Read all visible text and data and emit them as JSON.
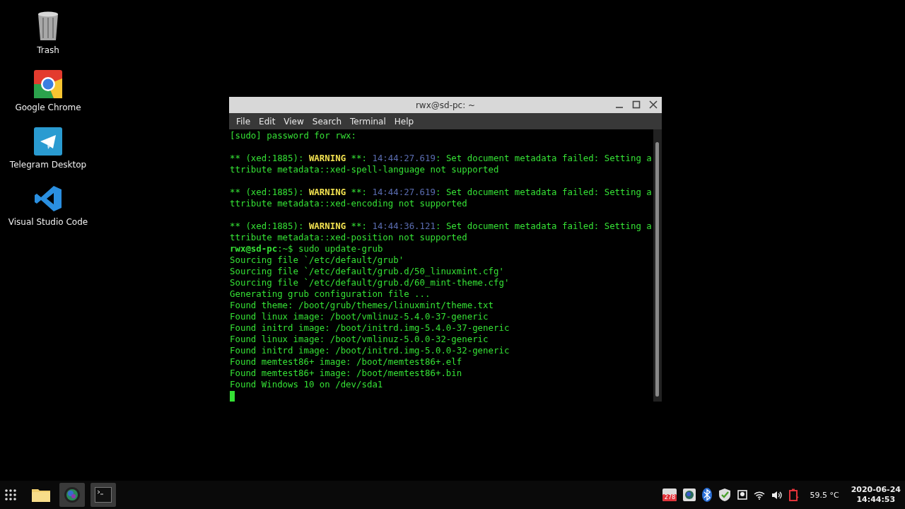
{
  "desktop_icons": [
    {
      "label": "Trash",
      "kind": "trash"
    },
    {
      "label": "Google Chrome",
      "kind": "chrome"
    },
    {
      "label": "Telegram Desktop",
      "kind": "telegram"
    },
    {
      "label": "Visual Studio Code",
      "kind": "vscode"
    }
  ],
  "window": {
    "title": "rwx@sd-pc: ~"
  },
  "menu": [
    "File",
    "Edit",
    "View",
    "Search",
    "Terminal",
    "Help"
  ],
  "terminal": {
    "blocks": [
      [
        [
          {
            "text": "[sudo] password for rwx:",
            "kind": "plain"
          }
        ]
      ],
      [
        [
          {
            "text": "** (xed:1885): ",
            "kind": "plain"
          },
          {
            "text": "WARNING",
            "kind": "warning"
          },
          {
            "text": " **: ",
            "kind": "plain"
          },
          {
            "text": "14:44:27.619",
            "kind": "time"
          },
          {
            "text": ": Set document metadata failed: Setting a",
            "kind": "plain"
          }
        ],
        [
          {
            "text": "ttribute metadata::xed-spell-language not supported",
            "kind": "plain"
          }
        ]
      ],
      [
        [
          {
            "text": "** (xed:1885): ",
            "kind": "plain"
          },
          {
            "text": "WARNING",
            "kind": "warning"
          },
          {
            "text": " **: ",
            "kind": "plain"
          },
          {
            "text": "14:44:27.619",
            "kind": "time"
          },
          {
            "text": ": Set document metadata failed: Setting a",
            "kind": "plain"
          }
        ],
        [
          {
            "text": "ttribute metadata::xed-encoding not supported",
            "kind": "plain"
          }
        ]
      ],
      [
        [
          {
            "text": "** (xed:1885): ",
            "kind": "plain"
          },
          {
            "text": "WARNING",
            "kind": "warning"
          },
          {
            "text": " **: ",
            "kind": "plain"
          },
          {
            "text": "14:44:36.121",
            "kind": "time"
          },
          {
            "text": ": Set document metadata failed: Setting a",
            "kind": "plain"
          }
        ],
        [
          {
            "text": "ttribute metadata::xed-position not supported",
            "kind": "plain"
          }
        ],
        [
          {
            "text": "rwx@sd-pc",
            "kind": "prompt"
          },
          {
            "text": ":~$ sudo update-grub",
            "kind": "plain"
          }
        ],
        [
          {
            "text": "Sourcing file `/etc/default/grub'",
            "kind": "plain"
          }
        ],
        [
          {
            "text": "Sourcing file `/etc/default/grub.d/50_linuxmint.cfg'",
            "kind": "plain"
          }
        ],
        [
          {
            "text": "Sourcing file `/etc/default/grub.d/60_mint-theme.cfg'",
            "kind": "plain"
          }
        ],
        [
          {
            "text": "Generating grub configuration file ...",
            "kind": "plain"
          }
        ],
        [
          {
            "text": "Found theme: /boot/grub/themes/linuxmint/theme.txt",
            "kind": "plain"
          }
        ],
        [
          {
            "text": "Found linux image: /boot/vmlinuz-5.4.0-37-generic",
            "kind": "plain"
          }
        ],
        [
          {
            "text": "Found initrd image: /boot/initrd.img-5.4.0-37-generic",
            "kind": "plain"
          }
        ],
        [
          {
            "text": "Found linux image: /boot/vmlinuz-5.0.0-32-generic",
            "kind": "plain"
          }
        ],
        [
          {
            "text": "Found initrd image: /boot/initrd.img-5.0.0-32-generic",
            "kind": "plain"
          }
        ],
        [
          {
            "text": "Found memtest86+ image: /boot/memtest86+.elf",
            "kind": "plain"
          }
        ],
        [
          {
            "text": "Found memtest86+ image: /boot/memtest86+.bin",
            "kind": "plain"
          }
        ],
        [
          {
            "text": "Found Windows 10 on /dev/sda1",
            "kind": "plain"
          }
        ]
      ]
    ]
  },
  "taskbar": {
    "apps": [
      {
        "kind": "folder",
        "active": false
      },
      {
        "kind": "camera",
        "active": true
      },
      {
        "kind": "terminal",
        "active": true
      }
    ],
    "mail_badge": "278",
    "temperature": "59.5 °C",
    "date": "2020-06-24",
    "time": "14:44:53"
  }
}
